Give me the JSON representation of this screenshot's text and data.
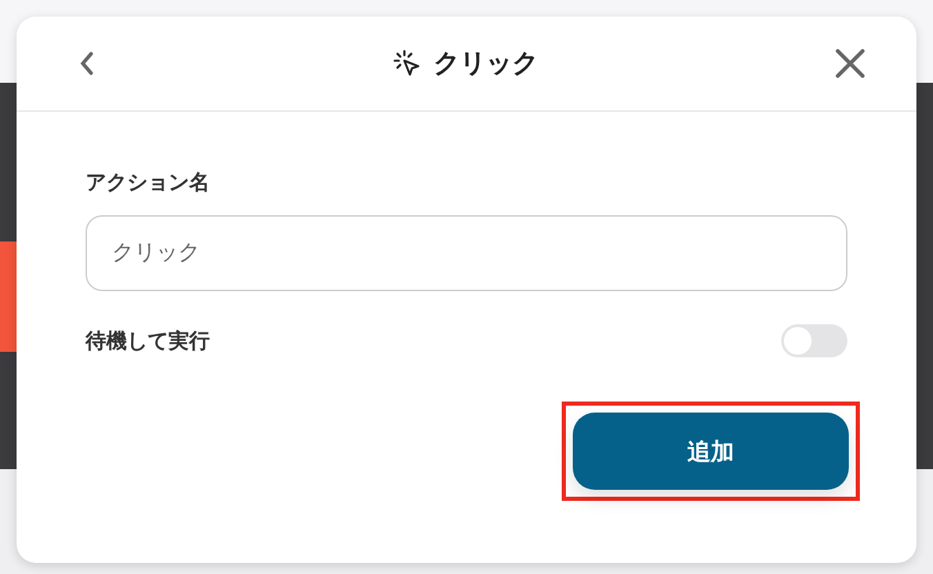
{
  "dialog": {
    "title": "クリック",
    "action_name": {
      "label": "アクション名",
      "value": "クリック"
    },
    "wait_toggle": {
      "label": "待機して実行",
      "on": false
    },
    "add_button": {
      "label": "追加",
      "highlighted": true
    }
  }
}
